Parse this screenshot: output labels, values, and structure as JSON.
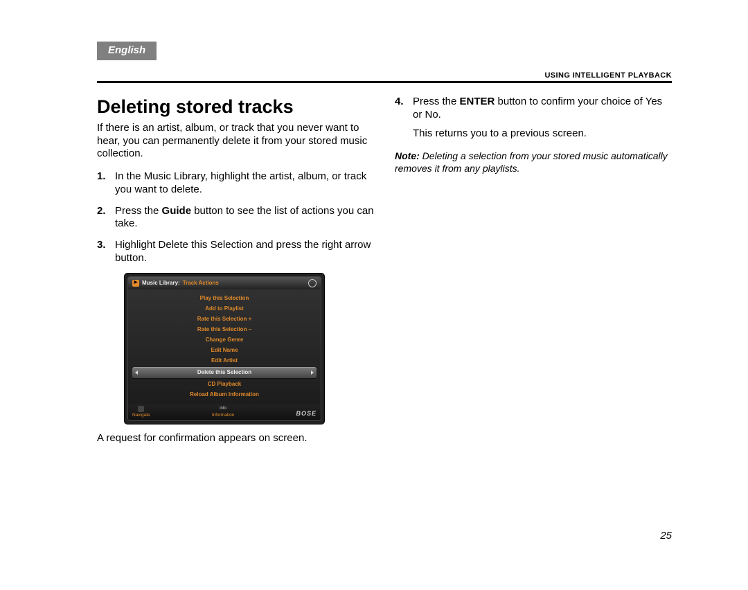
{
  "language_tab": "English",
  "running_header": "USING INTELLIGENT PLAYBACK",
  "title": "Deleting stored tracks",
  "intro": "If there is an artist, album, or track that you never want to hear, you can permanently delete it from your stored music collection.",
  "steps_left": [
    {
      "n": "1.",
      "text_before": "In the Music Library, highlight the artist, album, or track you want to delete.",
      "bold": "",
      "text_after": ""
    },
    {
      "n": "2.",
      "text_before": "Press the ",
      "bold": "Guide",
      "text_after": " button to see the list of actions you can take."
    },
    {
      "n": "3.",
      "text_before": "Highlight Delete this Selection and press the right arrow button.",
      "bold": "",
      "text_after": ""
    }
  ],
  "after_image_line": "A request for confirmation appears on screen.",
  "steps_right": [
    {
      "n": "4.",
      "text_before": "Press the ",
      "bold": "ENTER",
      "text_after": " button to confirm your choice of Yes or No."
    }
  ],
  "right_followup": "This returns you to a previous screen.",
  "note_label": "Note:",
  "note_body": "Deleting a selection from your stored music automatically removes it from any playlists.",
  "page_number": "25",
  "gui": {
    "title_1": "Music Library:",
    "title_2": "Track Actions",
    "items": [
      {
        "label": "Play this Selection",
        "selected": false
      },
      {
        "label": "Add to Playlist",
        "selected": false
      },
      {
        "label": "Rate this Selection +",
        "selected": false
      },
      {
        "label": "Rate this Selection –",
        "selected": false
      },
      {
        "label": "Change Genre",
        "selected": false
      },
      {
        "label": "Edit Name",
        "selected": false
      },
      {
        "label": "Edit Artist",
        "selected": false
      },
      {
        "label": "Delete this Selection",
        "selected": true
      },
      {
        "label": "CD Playback",
        "selected": false
      },
      {
        "label": "Reload Album Information",
        "selected": false
      }
    ],
    "footer_nav": "Navigate",
    "footer_info_top": "info",
    "footer_info_bottom": "Information",
    "brand": "BOSE"
  }
}
